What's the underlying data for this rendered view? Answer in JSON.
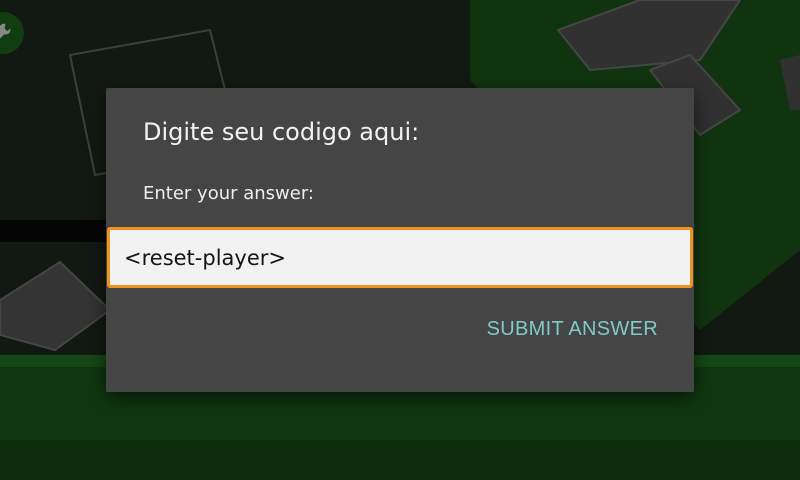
{
  "background": {
    "field_color": "#1a1a1a",
    "grass_color": "#1a5e1c",
    "accent_green": "#1c6b1f",
    "block_color": "#5a5a5a",
    "wrench_icon": "wrench-icon"
  },
  "dialog": {
    "title": "Digite seu codigo aqui:",
    "prompt_label": "Enter your answer:",
    "input_value": "<reset-player>",
    "submit_label": "SUBMIT ANSWER",
    "input_border_color": "#f0921e",
    "submit_color": "#80cbc4"
  }
}
